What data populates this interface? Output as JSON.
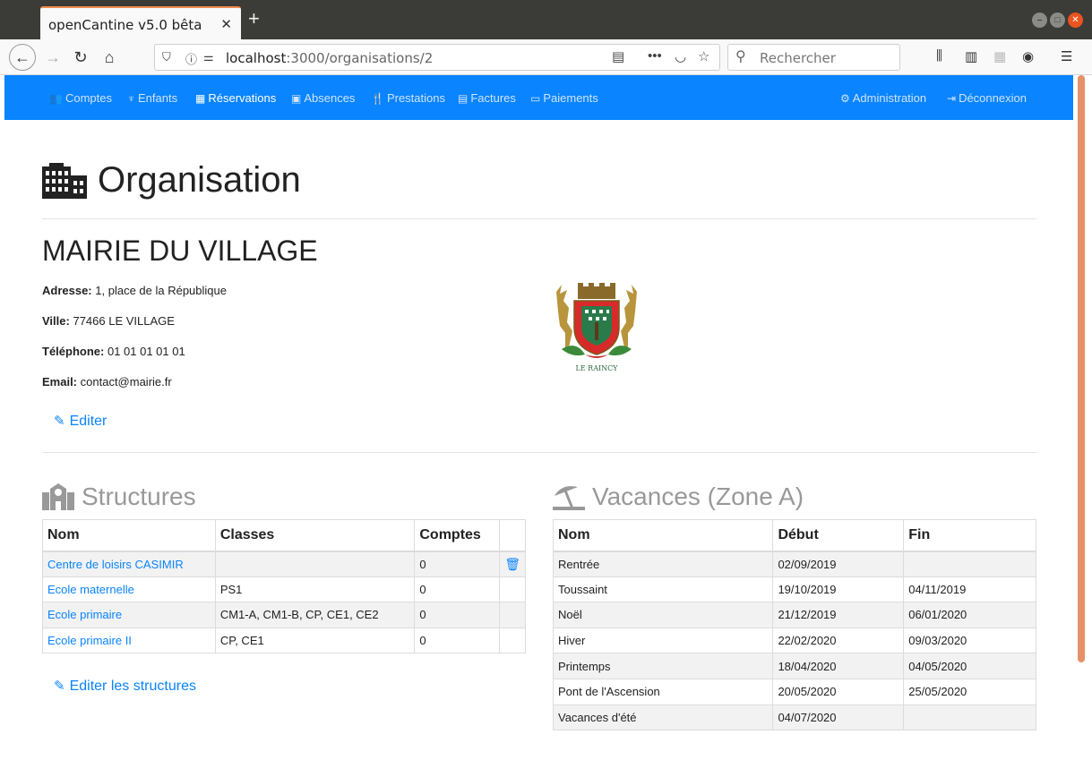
{
  "browser": {
    "tab_title": "openCantine v5.0 bêta",
    "url_host": "localhost",
    "url_path": ":3000/organisations/2",
    "search_placeholder": "Rechercher"
  },
  "app_nav": {
    "left": [
      {
        "label": "Comptes",
        "icon": "users-icon",
        "active": false
      },
      {
        "label": "Enfants",
        "icon": "child-icon",
        "active": false
      },
      {
        "label": "Réservations",
        "icon": "calendar-icon",
        "active": true
      },
      {
        "label": "Absences",
        "icon": "calendar-x-icon",
        "active": false
      },
      {
        "label": "Prestations",
        "icon": "utensils-icon",
        "active": false
      },
      {
        "label": "Factures",
        "icon": "file-icon",
        "active": false
      },
      {
        "label": "Paiements",
        "icon": "money-icon",
        "active": false
      }
    ],
    "right": [
      {
        "label": "Administration",
        "icon": "users-cog-icon"
      },
      {
        "label": "Déconnexion",
        "icon": "sign-out-icon"
      }
    ],
    "color": "#0a84ff"
  },
  "page_title": "Organisation",
  "org": {
    "name": "MAIRIE DU VILLAGE",
    "address_label": "Adresse:",
    "address": "1, place de la République",
    "city_label": "Ville:",
    "city": "77466 LE VILLAGE",
    "phone_label": "Téléphone:",
    "phone": "01 01 01 01 01",
    "email_label": "Email:",
    "email": "contact@mairie.fr",
    "edit_label": "Editer",
    "crest_caption": "LE RAINCY"
  },
  "structures": {
    "title": "Structures",
    "headers": [
      "Nom",
      "Classes",
      "Comptes",
      ""
    ],
    "rows": [
      {
        "nom": "Centre de loisirs CASIMIR",
        "classes": "",
        "comptes": "0",
        "deletable": true
      },
      {
        "nom": "Ecole maternelle",
        "classes": "PS1",
        "comptes": "0",
        "deletable": false
      },
      {
        "nom": "Ecole primaire",
        "classes": "CM1-A, CM1-B, CP, CE1, CE2",
        "comptes": "0",
        "deletable": false
      },
      {
        "nom": "Ecole primaire II",
        "classes": "CP, CE1",
        "comptes": "0",
        "deletable": false
      }
    ],
    "edit_label": "Editer les structures"
  },
  "vacances": {
    "title": "Vacances (Zone A)",
    "headers": [
      "Nom",
      "Début",
      "Fin"
    ],
    "rows": [
      {
        "nom": "Rentrée",
        "debut": "02/09/2019",
        "fin": ""
      },
      {
        "nom": "Toussaint",
        "debut": "19/10/2019",
        "fin": "04/11/2019"
      },
      {
        "nom": "Noël",
        "debut": "21/12/2019",
        "fin": "06/01/2020"
      },
      {
        "nom": "Hiver",
        "debut": "22/02/2020",
        "fin": "09/03/2020"
      },
      {
        "nom": "Printemps",
        "debut": "18/04/2020",
        "fin": "04/05/2020"
      },
      {
        "nom": "Pont de l'Ascension",
        "debut": "20/05/2020",
        "fin": "25/05/2020"
      },
      {
        "nom": "Vacances d'été",
        "debut": "04/07/2020",
        "fin": ""
      }
    ]
  }
}
